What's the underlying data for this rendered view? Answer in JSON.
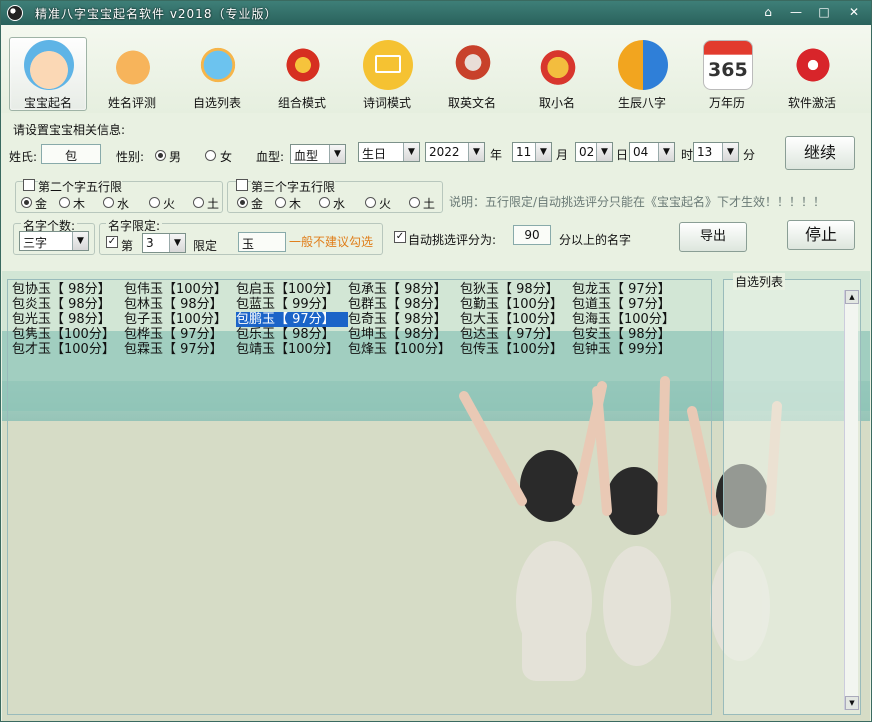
{
  "window": {
    "title": "精准八字宝宝起名软件 v2018（专业版）",
    "controls": [
      "⌂",
      "—",
      "□",
      "✕"
    ]
  },
  "toolbar": [
    {
      "label": "宝宝起名",
      "icon": "baby-icon",
      "active": true,
      "color": "#f3c58a"
    },
    {
      "label": "姓名评测",
      "icon": "cartoon-bear-icon",
      "color": "#f2a44b"
    },
    {
      "label": "自选列表",
      "icon": "bird-icon",
      "color": "#5ab0e0"
    },
    {
      "label": "组合模式",
      "icon": "lantern-icon",
      "color": "#d93426"
    },
    {
      "label": "诗词模式",
      "icon": "book-icon",
      "color": "#f4c431"
    },
    {
      "label": "取英文名",
      "icon": "eagle-icon",
      "color": "#c8402b"
    },
    {
      "label": "取小名",
      "icon": "tiger-face-icon",
      "color": "#d9342b"
    },
    {
      "label": "生辰八字",
      "icon": "yin-yang-icon",
      "color": "#2f7fd8"
    },
    {
      "label": "万年历",
      "icon": "calendar-365-icon",
      "color": "#ffffff"
    },
    {
      "label": "软件激活",
      "icon": "lock-icon",
      "color": "#d8252a"
    }
  ],
  "form": {
    "section_title": "请设置宝宝相关信息:",
    "surname_label": "姓氏:",
    "surname_value": "包",
    "gender_label": "性别:",
    "gender_male": "男",
    "gender_female": "女",
    "blood_label": "血型:",
    "blood_value": "血型",
    "date_type": "生日",
    "year": "2022",
    "year_unit": "年",
    "month": "11",
    "month_unit": "月",
    "day": "02",
    "day_unit": "日",
    "hour": "04",
    "hour_unit": "时",
    "minute": "13",
    "minute_unit": "分",
    "continue_label": "继续",
    "stop_label": "停止",
    "export_label": "导出",
    "wx2_label": "第二个字五行限",
    "wx3_label": "第三个字五行限",
    "elements": [
      "金",
      "木",
      "水",
      "火",
      "土"
    ],
    "note": "说明：五行限定/自动挑选评分只能在《宝宝起名》下才生效！！！！！",
    "count_title": "名字个数:",
    "count_value": "三字",
    "limit_title": "名字限定:",
    "limit_nth_label": "第",
    "limit_nth_value": "3",
    "limit_label": "限定",
    "limit_char": "玉",
    "limit_hint": "一般不建议勾选",
    "auto_label": "自动挑选评分为:",
    "auto_score": "90",
    "auto_suffix": "分以上的名字"
  },
  "results": [
    [
      "包协玉【 98分】",
      "包伟玉【100分】",
      "包启玉【100分】",
      "包承玉【 98分】",
      "包狄玉【 98分】",
      "包龙玉【 97分】"
    ],
    [
      "包炎玉【 98分】",
      "包林玉【 98分】",
      "包蓝玉【 99分】",
      "包群玉【 98分】",
      "包勤玉【100分】",
      "包道玉【 97分】"
    ],
    [
      "包光玉【 98分】",
      "包子玉【100分】",
      "包鹏玉【 97分】",
      "包奇玉【 98分】",
      "包大玉【100分】",
      "包海玉【100分】"
    ],
    [
      "包隽玉【100分】",
      "包桦玉【 97分】",
      "包乐玉【 98分】",
      "包坤玉【 98分】",
      "包达玉【 97分】",
      "包安玉【 98分】"
    ],
    [
      "包才玉【100分】",
      "包霖玉【 97分】",
      "包靖玉【100分】",
      "包烽玉【100分】",
      "包传玉【100分】",
      "包钟玉【 99分】"
    ]
  ],
  "selected": {
    "row": 2,
    "col": 2
  },
  "side_title": "自选列表"
}
